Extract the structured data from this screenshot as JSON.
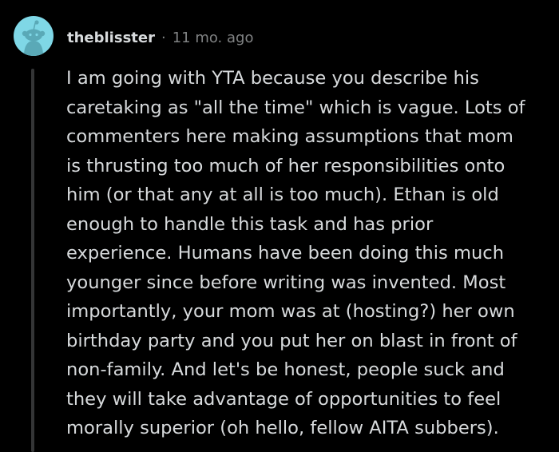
{
  "comment": {
    "author": "theblisster",
    "separator": "·",
    "timestamp": "11 mo. ago",
    "avatar_icon": "reddit-snoo-avatar-icon",
    "body": "I am going with YTA because you describe his\ncaretaking as \"all the time\" which is vague. Lots of\ncommenters here making assumptions that mom\nis thrusting too much of her responsibilities onto\nhim (or that any at all is too much). Ethan is old\nenough to handle this task and has prior\nexperience. Humans have been doing this much\nyounger since before writing was invented. Most\nimportantly, your mom was at (hosting?) her own\nbirthday party and you put her on blast in front of\nnon-family. And let's be honest, people suck and\nthey will take advantage of opportunities to feel\nmorally superior (oh hello, fellow AITA subbers)."
  },
  "colors": {
    "background": "#000000",
    "text_primary": "#d7dadc",
    "text_meta": "#818384",
    "thread_line": "#343536",
    "avatar_background": "#7fd7e6",
    "avatar_figure": "#5aa9b7"
  }
}
